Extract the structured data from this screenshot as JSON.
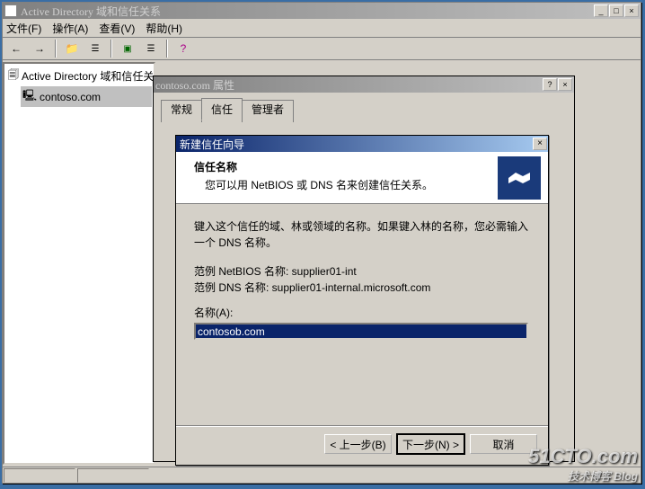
{
  "main_window": {
    "title": "Active Directory 域和信任关系",
    "menu": {
      "file": "文件(F)",
      "action": "操作(A)",
      "view": "查看(V)",
      "help": "帮助(H)"
    },
    "tree": {
      "root": "Active Directory 域和信任关系",
      "child": "contoso.com"
    }
  },
  "prop_dialog": {
    "title": "contoso.com 属性",
    "tabs": {
      "general": "常规",
      "trusts": "信任",
      "managed_by": "管理者"
    }
  },
  "wizard": {
    "title": "新建信任向导",
    "header_title": "信任名称",
    "header_sub": "您可以用 NetBIOS 或 DNS 名来创建信任关系。",
    "instr1": "键入这个信任的域、林或领域的名称。如果键入林的名称，您必需输入一个 DNS 名称。",
    "example_nb": "范例 NetBIOS 名称: supplier01-int",
    "example_dns": "范例 DNS 名称: supplier01-internal.microsoft.com",
    "name_label": "名称(A):",
    "name_value": "contosob.com",
    "btn_back": "< 上一步(B)",
    "btn_next": "下一步(N) >",
    "btn_cancel": "取消"
  },
  "watermark": {
    "main": "51CTO.com",
    "sub": "技术博客 Blog"
  }
}
